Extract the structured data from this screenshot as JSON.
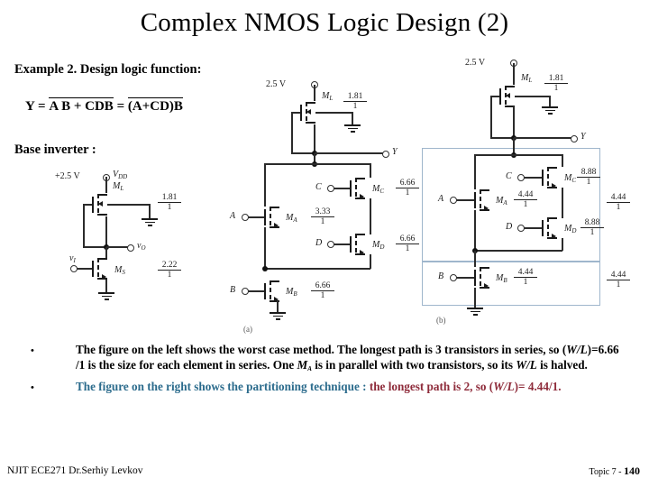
{
  "slide": {
    "title": "Complex NMOS Logic Design (2)"
  },
  "left_column": {
    "example_heading": "Example 2. Design logic function:",
    "formula": {
      "lhs": "Y =",
      "term1": "A B + CDB",
      "equals": "=",
      "term2": "(A+CD)B"
    },
    "base_inverter_label": "Base inverter :"
  },
  "circuits": {
    "inverter": {
      "supply_label": "+2.5 V",
      "vdd_label": "VDD",
      "load_name": "ML",
      "load_ratio_num": "1.81",
      "load_ratio_den": "1",
      "driver_name": "MS",
      "driver_ratio_num": "2.22",
      "driver_ratio_den": "1",
      "input_label": "vI",
      "output_label": "vO"
    },
    "worst_case": {
      "caption": "(a)",
      "supply_label": "2.5 V",
      "load_name": "ML",
      "load_ratio_num": "1.81",
      "load_ratio_den": "1",
      "output_label": "Y",
      "devices": [
        {
          "input": "A",
          "name": "MA",
          "ratio_num": "3.33",
          "ratio_den": "1"
        },
        {
          "input": "C",
          "name": "MC",
          "ratio_num": "6.66",
          "ratio_den": "1"
        },
        {
          "input": "D",
          "name": "MD",
          "ratio_num": "6.66",
          "ratio_den": "1"
        },
        {
          "input": "B",
          "name": "MB",
          "ratio_num": "6.66",
          "ratio_den": "1"
        }
      ]
    },
    "partitioned": {
      "caption": "(b)",
      "supply_label": "2.5 V",
      "load_name": "ML",
      "load_ratio_num": "1.81",
      "load_ratio_den": "1",
      "output_label": "Y",
      "devices": [
        {
          "input": "A",
          "name": "MA",
          "ratio_num": "4.44",
          "ratio_den": "1"
        },
        {
          "input": "C",
          "name": "MC",
          "ratio_num": "8.88",
          "ratio_den": "1"
        },
        {
          "input": "D",
          "name": "MD",
          "ratio_num": "8.88",
          "ratio_den": "1"
        },
        {
          "input": "B",
          "name": "MB",
          "ratio_num": "4.44",
          "ratio_den": "1"
        }
      ],
      "partition_ratios": [
        {
          "num": "4.44",
          "den": "1"
        },
        {
          "num": "4.44",
          "den": "1"
        }
      ],
      "partition_border_color": "#9fb6cc"
    }
  },
  "bullets": [
    {
      "marker": "•",
      "segments": [
        {
          "text": "The figure on the left shows the worst case method. The longest path is 3 transistors in series, so (",
          "style": "plain"
        },
        {
          "text": "W/L",
          "style": "italic"
        },
        {
          "text": ")=6.66 /1 is the size for each element in series.  One  ",
          "style": "plain"
        },
        {
          "text": "MA",
          "style": "italic-sub"
        },
        {
          "text": "  is in parallel with two transistors, so its ",
          "style": "plain"
        },
        {
          "text": "W/L",
          "style": "italic"
        },
        {
          "text": " is halved.",
          "style": "plain"
        }
      ]
    },
    {
      "marker": "•",
      "segments": [
        {
          "text": "The figure on the right shows the partitioning technique : ",
          "style": "teal"
        },
        {
          "text": "the longest path is 2, so (",
          "style": "red"
        },
        {
          "text": "W/L",
          "style": "red-italic"
        },
        {
          "text": ")= 4.44/1.",
          "style": "red"
        }
      ]
    }
  ],
  "footer": {
    "left": "NJIT  ECE271   Dr.Serhiy Levkov",
    "topic_prefix": "Topic 7 - ",
    "topic_number": "140"
  },
  "colors": {
    "teal": "#2b6b8c",
    "red": "#8e2b3a",
    "wire": "#2b2b2b",
    "partition_border": "#9fb6cc"
  }
}
